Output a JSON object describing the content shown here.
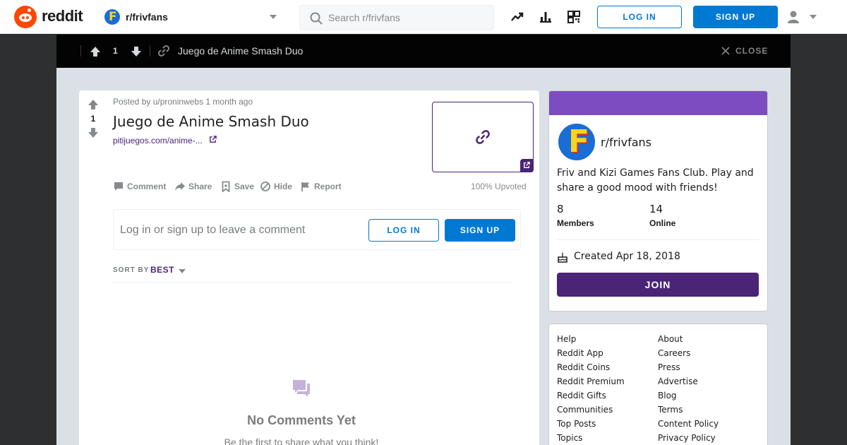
{
  "header": {
    "logo_text": "reddit",
    "subreddit": "r/frivfans",
    "subreddit_icon_letter": "F",
    "search_placeholder": "Search r/frivfans",
    "login_label": "LOG IN",
    "signup_label": "SIGN UP",
    "icons": [
      "popular-icon",
      "all-icon",
      "qr-code-icon",
      "user-icon"
    ]
  },
  "topbar": {
    "score": "1",
    "title": "Juego de Anime Smash Duo",
    "close_label": "CLOSE"
  },
  "post": {
    "score": "1",
    "meta": "Posted by u/proninwebs 1 month ago",
    "title": "Juego de Anime Smash Duo",
    "link_text": "pitijuegos.com/anime-...",
    "actions": {
      "comment": "Comment",
      "share": "Share",
      "save": "Save",
      "hide": "Hide",
      "report": "Report"
    },
    "upvoted": "100% Upvoted",
    "login_prompt": "Log in or sign up to leave a comment",
    "login_label": "LOG IN",
    "signup_label": "SIGN UP",
    "sort_label": "SORT BY",
    "sort_value": "BEST",
    "no_comments_title": "No Comments Yet",
    "no_comments_sub": "Be the first to share what you think!"
  },
  "sidebar": {
    "name": "r/frivfans",
    "avatar_letter": "F",
    "description": "Friv and Kizi Games Fans Club. Play and share a good mood with friends!",
    "members_count": "8",
    "members_label": "Members",
    "online_count": "14",
    "online_label": "Online",
    "created": "Created Apr 18, 2018",
    "join_label": "JOIN",
    "band_color": "#7d4cc0",
    "join_color": "#4a2477"
  },
  "footer": {
    "col1": [
      "Help",
      "Reddit App",
      "Reddit Coins",
      "Reddit Premium",
      "Reddit Gifts",
      "Communities",
      "Top Posts",
      "Topics"
    ],
    "col2": [
      "About",
      "Careers",
      "Press",
      "Advertise",
      "Blog",
      "Terms",
      "Content Policy",
      "Privacy Policy"
    ]
  }
}
